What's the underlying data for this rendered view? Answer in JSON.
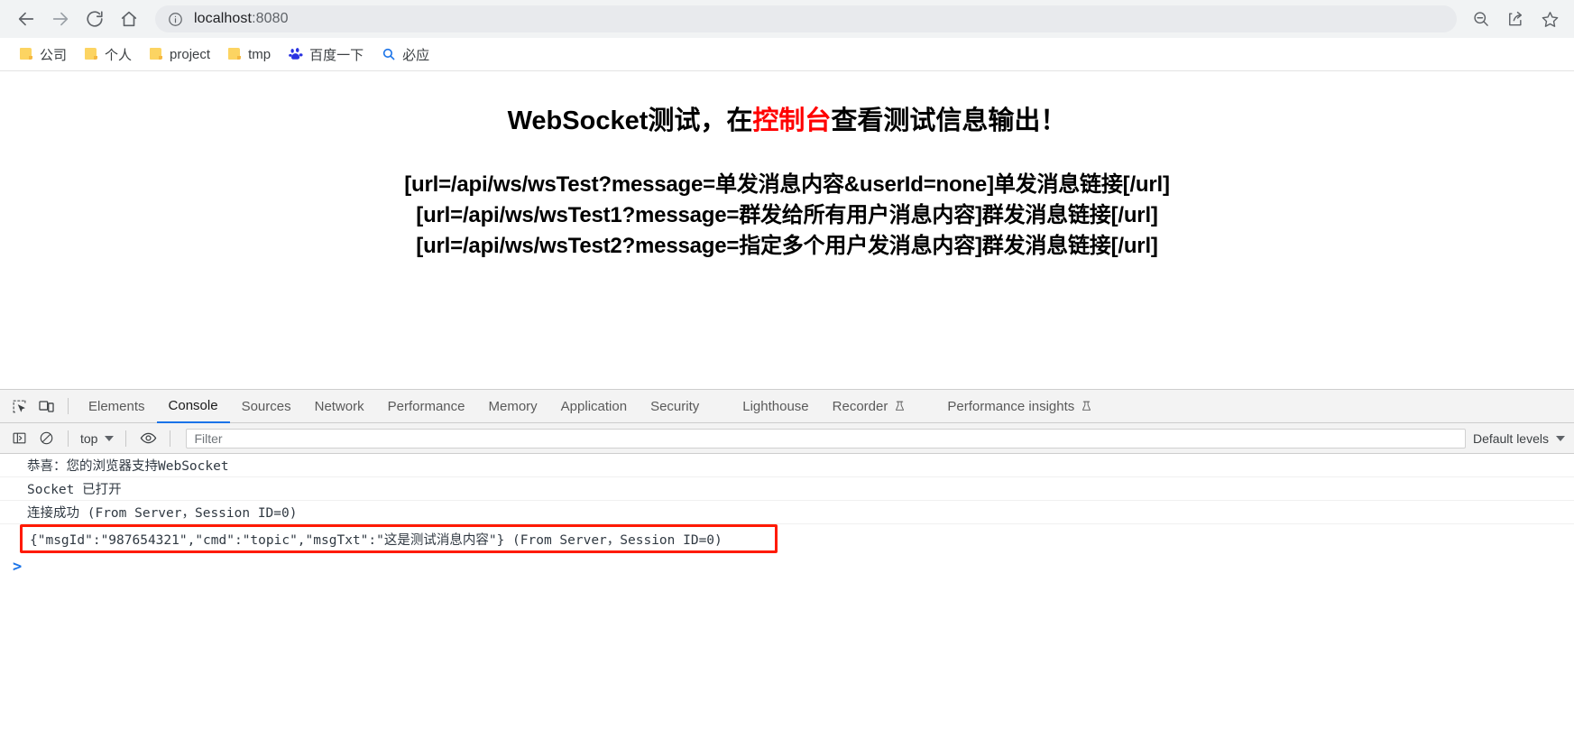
{
  "browser": {
    "nav": {
      "back": "back-arrow",
      "forward": "forward-arrow",
      "reload": "reload",
      "home": "home"
    },
    "omnibox": {
      "host": "localhost",
      "port": ":8080",
      "info_icon": "info-circle-icon"
    },
    "right_icons": [
      "zoom-out-icon",
      "share-icon",
      "bookmark-star-icon"
    ],
    "bookmarks": [
      {
        "label": "公司",
        "icon": "folder-icon"
      },
      {
        "label": "个人",
        "icon": "folder-icon"
      },
      {
        "label": "project",
        "icon": "folder-icon"
      },
      {
        "label": "tmp",
        "icon": "folder-icon"
      },
      {
        "label": "百度一下",
        "icon": "baidu-icon"
      },
      {
        "label": "必应",
        "icon": "bing-search-icon"
      }
    ]
  },
  "page": {
    "title_pre": "WebSocket测试，在",
    "title_highlight": "控制台",
    "title_post": "查看测试信息输出！",
    "highlight_color": "#ff0000",
    "links": [
      "[url=/api/ws/wsTest?message=单发消息内容&userId=none]单发消息链接[/url]",
      "[url=/api/ws/wsTest1?message=群发给所有用户消息内容]群发消息链接[/url]",
      "[url=/api/ws/wsTest2?message=指定多个用户发消息内容]群发消息链接[/url]"
    ]
  },
  "devtools": {
    "left_icons": [
      "inspect-element-icon",
      "device-toolbar-icon"
    ],
    "tabs": [
      {
        "label": "Elements",
        "active": false,
        "flask": false
      },
      {
        "label": "Console",
        "active": true,
        "flask": false
      },
      {
        "label": "Sources",
        "active": false,
        "flask": false
      },
      {
        "label": "Network",
        "active": false,
        "flask": false
      },
      {
        "label": "Performance",
        "active": false,
        "flask": false
      },
      {
        "label": "Memory",
        "active": false,
        "flask": false
      },
      {
        "label": "Application",
        "active": false,
        "flask": false
      },
      {
        "label": "Security",
        "active": false,
        "flask": false
      },
      {
        "label": "Lighthouse",
        "active": false,
        "flask": false
      },
      {
        "label": "Recorder",
        "active": false,
        "flask": true
      },
      {
        "label": "Performance insights",
        "active": false,
        "flask": true
      }
    ],
    "active_tab_underline_color": "#1a73e8",
    "filterbar": {
      "sidebar_icon": "console-sidebar-icon",
      "clear_icon": "clear-console-icon",
      "context": "top",
      "eye_icon": "live-expression-eye-icon",
      "filter_placeholder": "Filter",
      "filter_value": "",
      "levels": "Default levels"
    },
    "console_logs": [
      {
        "text": "恭喜：您的浏览器支持WebSocket",
        "boxed": false
      },
      {
        "text": "Socket 已打开",
        "boxed": false
      },
      {
        "text": "连接成功 (From Server，Session ID=0)",
        "boxed": false
      },
      {
        "text": "{\"msgId\":\"987654321\",\"cmd\":\"topic\",\"msgTxt\":\"这是测试消息内容\"} (From Server，Session ID=0)",
        "boxed": true
      }
    ],
    "highlight_box_color": "#ff1a00",
    "prompt": ">"
  }
}
